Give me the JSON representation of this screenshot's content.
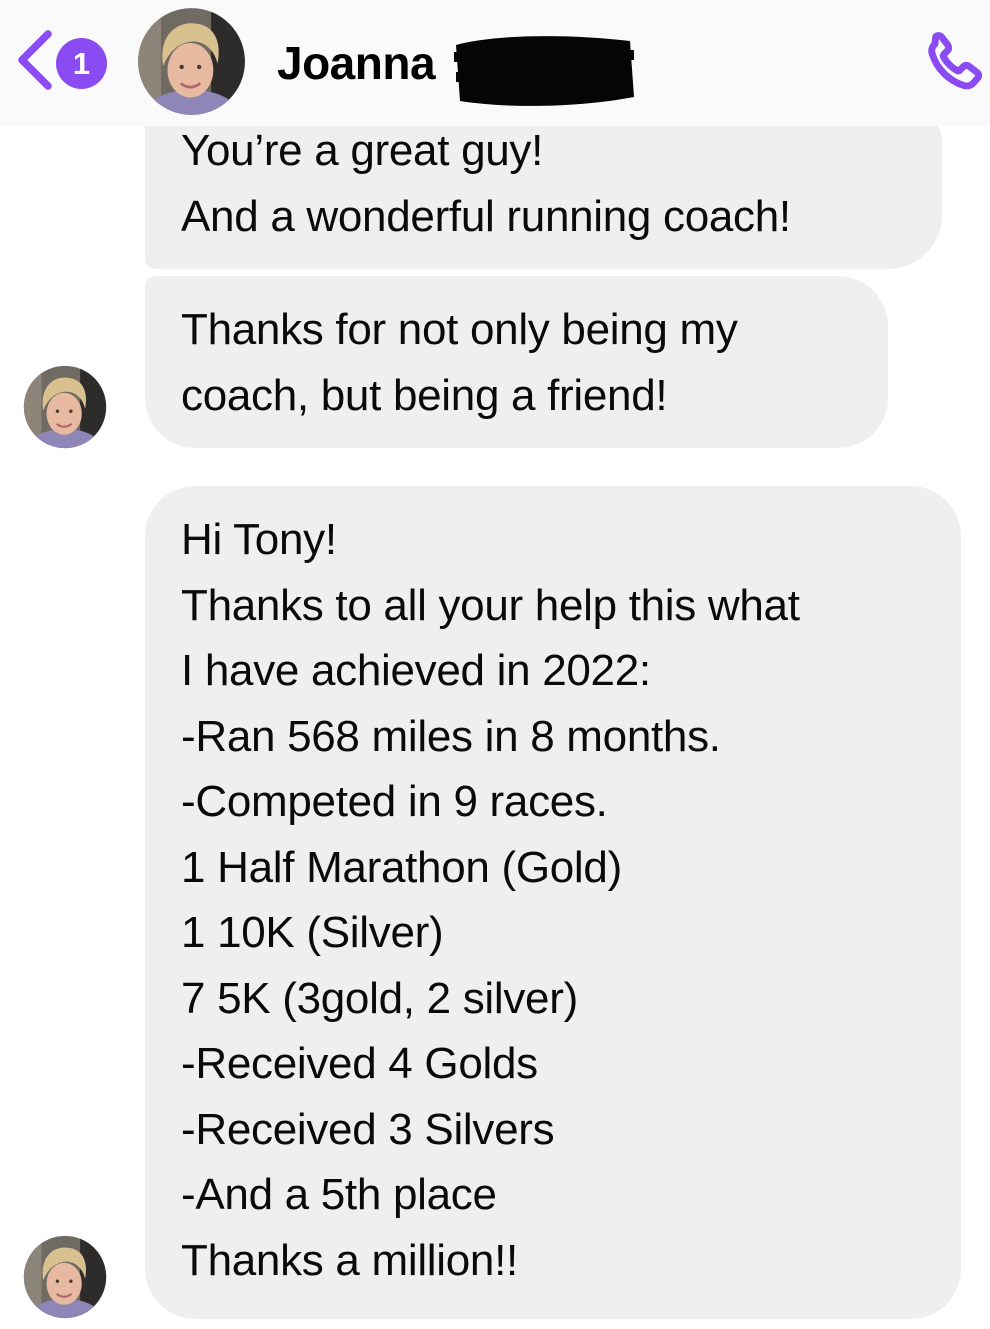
{
  "header": {
    "back_label": "back",
    "unread_count": "1",
    "contact_name": "Joanna",
    "colors": {
      "accent": "#8a4cf2",
      "header_bg": "#fafafa",
      "bubble_bg": "#efefef"
    },
    "icons": {
      "back": "chevron-left-icon",
      "call": "phone-call-icon"
    }
  },
  "messages": [
    {
      "lines": [
        "You’re a great guy!",
        "And a wonderful running coach!"
      ]
    },
    {
      "lines": [
        "Thanks for not only being my",
        "coach, but being a friend!"
      ]
    },
    {
      "lines": [
        "Hi Tony!",
        "Thanks to all your help this what",
        "I have achieved in 2022:",
        "-Ran 568 miles in 8 months.",
        "-Competed in 9 races.",
        "1 Half Marathon (Gold)",
        "1 10K (Silver)",
        "7 5K (3gold, 2 silver)",
        "-Received 4 Golds",
        "-Received 3 Silvers",
        "-And a 5th place",
        "Thanks a million!!"
      ]
    }
  ]
}
